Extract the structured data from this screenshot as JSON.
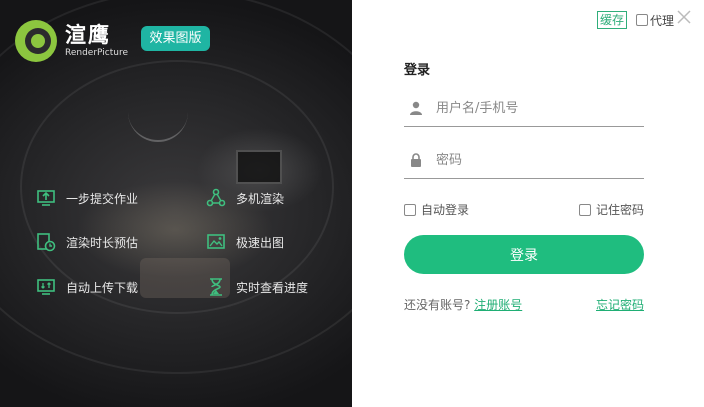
{
  "brand": {
    "name": "渲鹰",
    "subname": "RenderPicture",
    "badge": "效果图版",
    "accent": "#1fb5a3",
    "logo_color": "#8cc63f"
  },
  "features": [
    {
      "label": "一步提交作业",
      "icon": "upload-monitor-icon"
    },
    {
      "label": "多机渲染",
      "icon": "network-nodes-icon"
    },
    {
      "label": "渲染时长预估",
      "icon": "clock-document-icon"
    },
    {
      "label": "极速出图",
      "icon": "image-speed-icon"
    },
    {
      "label": "自动上传下载",
      "icon": "transfer-monitor-icon"
    },
    {
      "label": "实时查看进度",
      "icon": "hourglass-icon"
    }
  ],
  "top_options": {
    "cache_label": "缓存",
    "proxy_label": "代理",
    "close_icon": "close-icon"
  },
  "login": {
    "title": "登录",
    "username_placeholder": "用户名/手机号",
    "password_placeholder": "密码",
    "auto_login_label": "自动登录",
    "remember_password_label": "记住密码",
    "submit_label": "登录",
    "no_account_text": "还没有账号?",
    "register_link": "注册账号",
    "forgot_link": "忘记密码",
    "button_color": "#1fbd7f",
    "link_color": "#1fae74"
  }
}
